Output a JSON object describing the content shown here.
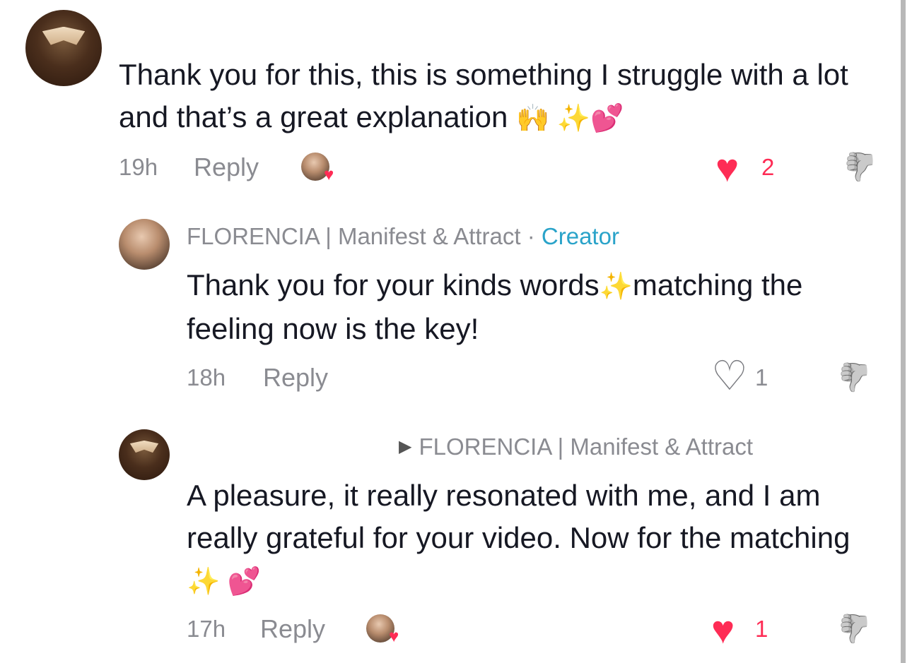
{
  "comments": [
    {
      "text": "Thank you for this, this is something I struggle with a lot and that’s a great explanation",
      "emojis": "🙌 ✨💕",
      "time": "19h",
      "reply_label": "Reply",
      "likes": "2",
      "liked": true
    },
    {
      "username": "FLORENCIA | Manifest & Attract",
      "separator": " · ",
      "creator_label": "Creator",
      "text_a": "Thank you for your kinds words",
      "emoji_mid": "✨",
      "text_b": "matching the feeling now is the key!",
      "time": "18h",
      "reply_label": "Reply",
      "likes": "1",
      "liked": false
    },
    {
      "reply_to": "FLORENCIA | Manifest & Attract",
      "text": "A pleasure, it really resonated with me, and I am really grateful for your video. Now for the matching",
      "emojis": "✨ 💕",
      "time": "17h",
      "reply_label": "Reply",
      "likes": "1",
      "liked": true
    }
  ],
  "icons": {
    "heart_filled": "♥",
    "heart_outline": "♡",
    "dislike": "👍",
    "reply_arrow": "▶"
  },
  "colors": {
    "like": "#fe2c55",
    "creator": "#2aa3c9",
    "muted": "#8a8b91"
  }
}
